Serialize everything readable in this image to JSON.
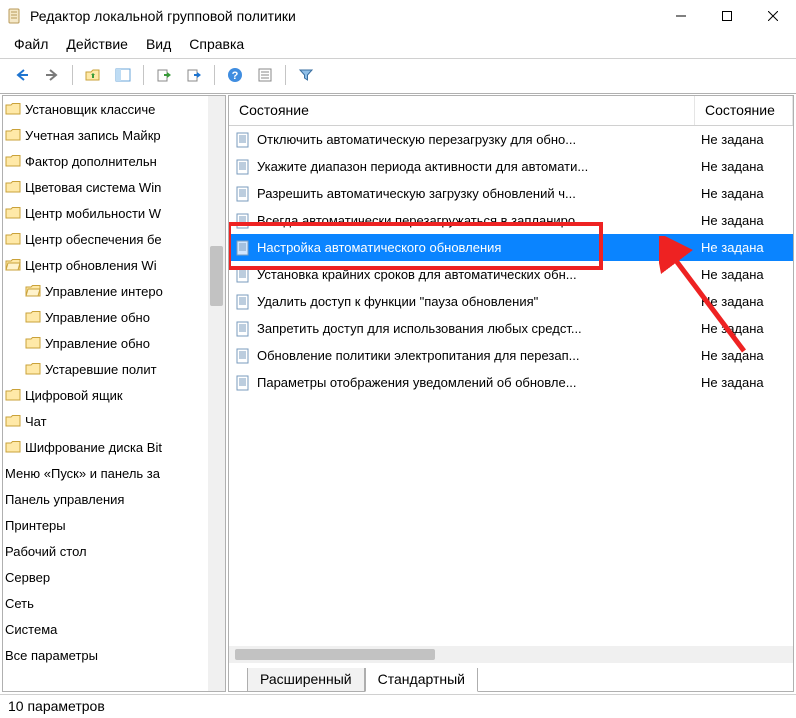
{
  "title": "Редактор локальной групповой политики",
  "menu": [
    "Файл",
    "Действие",
    "Вид",
    "Справка"
  ],
  "tree": [
    {
      "label": "Установщик классиче",
      "depth": 0,
      "icon": "folder"
    },
    {
      "label": "Учетная запись Майкр",
      "depth": 0,
      "icon": "folder"
    },
    {
      "label": "Фактор дополнительн",
      "depth": 0,
      "icon": "folder"
    },
    {
      "label": "Цветовая система Win",
      "depth": 0,
      "icon": "folder"
    },
    {
      "label": "Центр мобильности W",
      "depth": 0,
      "icon": "folder"
    },
    {
      "label": "Центр обеспечения бе",
      "depth": 0,
      "icon": "folder"
    },
    {
      "label": "Центр обновления Wi",
      "depth": 0,
      "icon": "folder-open"
    },
    {
      "label": "Управление интеро",
      "depth": 1,
      "icon": "folder-open"
    },
    {
      "label": "Управление обно",
      "depth": 1,
      "icon": "folder"
    },
    {
      "label": "Управление обно",
      "depth": 1,
      "icon": "folder"
    },
    {
      "label": "Устаревшие полит",
      "depth": 1,
      "icon": "folder"
    },
    {
      "label": "Цифровой ящик",
      "depth": 0,
      "icon": "folder"
    },
    {
      "label": "Чат",
      "depth": 0,
      "icon": "folder"
    },
    {
      "label": "Шифрование диска Bit",
      "depth": 0,
      "icon": "folder"
    },
    {
      "label": "Меню «Пуск» и панель за",
      "depth": 0,
      "icon": "none"
    },
    {
      "label": "Панель управления",
      "depth": 0,
      "icon": "none"
    },
    {
      "label": "Принтеры",
      "depth": 0,
      "icon": "none"
    },
    {
      "label": "Рабочий стол",
      "depth": 0,
      "icon": "none"
    },
    {
      "label": "Сервер",
      "depth": 0,
      "icon": "none"
    },
    {
      "label": "Сеть",
      "depth": 0,
      "icon": "none"
    },
    {
      "label": "Система",
      "depth": 0,
      "icon": "none"
    },
    {
      "label": "Все параметры",
      "depth": 0,
      "icon": "none"
    }
  ],
  "grid": {
    "columns": [
      "Состояние",
      "Состояние"
    ],
    "rows": [
      {
        "name": "Отключить автоматическую перезагрузку для обно...",
        "state": "Не задана",
        "selected": false
      },
      {
        "name": "Укажите диапазон периода активности для автомати...",
        "state": "Не задана",
        "selected": false
      },
      {
        "name": "Разрешить автоматическую загрузку обновлений ч...",
        "state": "Не задана",
        "selected": false
      },
      {
        "name": "Всегда автоматически перезагружаться в запланиро...",
        "state": "Не задана",
        "selected": false
      },
      {
        "name": "Настройка автоматического обновления",
        "state": "Не задана",
        "selected": true
      },
      {
        "name": "Установка крайних сроков для автоматических обн...",
        "state": "Не задана",
        "selected": false
      },
      {
        "name": "Удалить доступ к функции \"пауза обновления\"",
        "state": "Не задана",
        "selected": false
      },
      {
        "name": "Запретить доступ для использования любых средст...",
        "state": "Не задана",
        "selected": false
      },
      {
        "name": "Обновление политики электропитания для перезап...",
        "state": "Не задана",
        "selected": false
      },
      {
        "name": "Параметры отображения уведомлений об обновле...",
        "state": "Не задана",
        "selected": false
      }
    ]
  },
  "tabs": {
    "items": [
      "Расширенный",
      "Стандартный"
    ],
    "active": 1
  },
  "status": "10 параметров"
}
